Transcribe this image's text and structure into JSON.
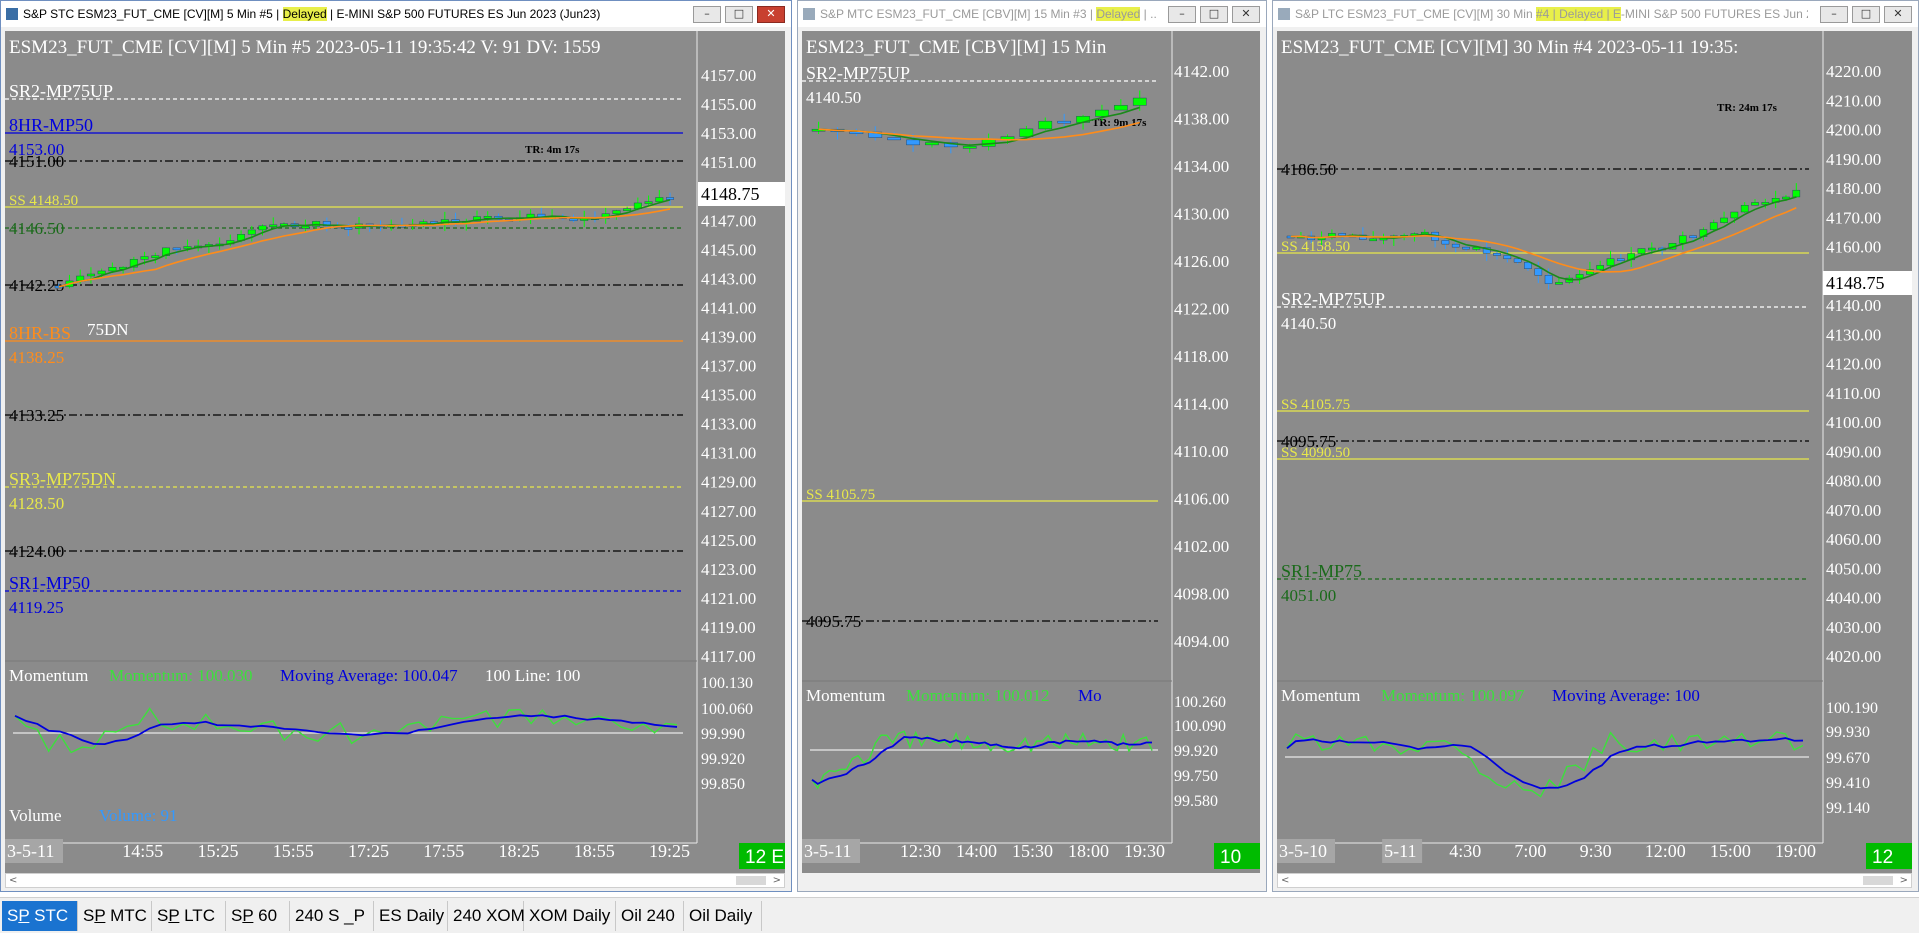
{
  "colors": {
    "chart_bg": "#8b8b8b",
    "up": "#00ff00",
    "down": "#3399ff",
    "sma_fast": "#1a8a1a",
    "sma_slow": "#ff8c1a",
    "yellow": "#e8e84a",
    "blue": "#0000dd",
    "dark_green": "#1a6a1a",
    "momentum": "#3ce03c",
    "mavg": "#0000dd",
    "highlight": "#e8ef4a"
  },
  "windows": [
    {
      "id": "stc",
      "focused": true,
      "title_pre": "S&P STC  ESM23_FUT_CME [CV][M]  5 Min  #5 | ",
      "title_hl": "Delayed",
      "title_post": " | E-MINI S&P 500 FUTURES ES Jun 2023 (Jun23)",
      "header": "ESM23_FUT_CME [CV][M]  5 Min   #5 2023-05-11 19:35:42 V: 91 DV: 1559",
      "tr_label": "TR: 4m 17s",
      "price_ticks": [
        "4157.00",
        "4155.00",
        "4153.00",
        "4151.00",
        "4149.00",
        "4147.00",
        "4145.00",
        "4143.00",
        "4141.00",
        "4139.00",
        "4137.00",
        "4135.00",
        "4133.00",
        "4131.00",
        "4129.00",
        "4127.00",
        "4125.00",
        "4123.00",
        "4121.00",
        "4119.00",
        "4117.00"
      ],
      "last_price": "4148.75",
      "levels": [
        {
          "name": "SR2-MP75UP",
          "value": null,
          "color": "white",
          "style": "dash",
          "sub": ""
        },
        {
          "name": "8HR-MP50",
          "value": "4153.00",
          "color": "blue",
          "style": "solid",
          "sub": ""
        },
        {
          "name": "",
          "value": "4151.00",
          "color": "black",
          "style": "dashdot",
          "sub": ""
        },
        {
          "name": "SS  4148.50",
          "value": null,
          "color": "yellow",
          "style": "solid",
          "sub": ""
        },
        {
          "name": "",
          "value": "4146.50",
          "color": "dark_green",
          "style": "dash",
          "sub": ""
        },
        {
          "name": "",
          "value": "4142.25",
          "color": "black",
          "style": "dashdot",
          "sub": ""
        },
        {
          "name": "8HR-BS",
          "value": "4138.25",
          "color": "orange",
          "style": "solid",
          "sub": "75DN"
        },
        {
          "name": "",
          "value": "4133.25",
          "color": "black",
          "style": "dashdot",
          "sub": ""
        },
        {
          "name": "SR3-MP75DN",
          "value": "4128.50",
          "color": "yellow",
          "style": "dash",
          "sub": ""
        },
        {
          "name": "",
          "value": "4124.00",
          "color": "black",
          "style": "dashdot",
          "sub": ""
        },
        {
          "name": "SR1-MP50",
          "value": "4119.25",
          "color": "blue",
          "style": "dash",
          "sub": ""
        }
      ],
      "momentum_label": "Momentum",
      "momentum_value": "Momentum: 100.030",
      "mavg_value": "Moving Average: 100.047",
      "line100": "100 Line: 100",
      "mom_ticks": [
        "100.130",
        "100.060",
        "99.990",
        "99.920",
        "99.850"
      ],
      "volume_label": "Volume",
      "volume_value": "Volume: 91",
      "time_labels": [
        "3-5-11",
        "14:55",
        "15:25",
        "15:55",
        "17:25",
        "17:55",
        "18:25",
        "18:55",
        "19:25"
      ],
      "corner": "12 E"
    },
    {
      "id": "mtc",
      "focused": false,
      "title_pre": "S&P MTC  ESM23_FUT_CME [CBV][M]  15 Min  #3 | ",
      "title_hl": "Delayed",
      "title_post": " | ...",
      "header": "ESM23_FUT_CME [CBV][M]  15 Min",
      "tr_label": "TR: 9m 17s",
      "price_ticks": [
        "4142.00",
        "4138.00",
        "4134.00",
        "4130.00",
        "4126.00",
        "4122.00",
        "4118.00",
        "4114.00",
        "4110.00",
        "4106.00",
        "4102.00",
        "4098.00",
        "4094.00"
      ],
      "last_price": "",
      "levels": [
        {
          "name": "SR2-MP75UP",
          "value": "4140.50",
          "color": "white",
          "style": "dash",
          "sub": ""
        },
        {
          "name": "SS  4105.75",
          "value": null,
          "color": "yellow",
          "style": "solid",
          "sub": ""
        },
        {
          "name": "",
          "value": "4095.75",
          "color": "black",
          "style": "dashdot",
          "sub": ""
        }
      ],
      "momentum_label": "Momentum",
      "momentum_value": "Momentum: 100.012",
      "mavg_value": "Mo",
      "line100": "",
      "mom_ticks": [
        "100.260",
        "100.090",
        "99.920",
        "99.750",
        "99.580"
      ],
      "volume_label": "",
      "volume_value": "",
      "time_labels": [
        "3-5-11",
        "12:30",
        "14:00",
        "15:30",
        "18:00",
        "19:30"
      ],
      "corner": "10"
    },
    {
      "id": "ltc",
      "focused": false,
      "title_pre": "S&P LTC  ESM23_FUT_CME [CV][M]  30 Min  ",
      "title_hl": "#4 | Delayed | E",
      "title_post": "-MINI S&P 500 FUTURES ES Jun 2...",
      "header": "ESM23_FUT_CME [CV][M]  30 Min   #4 2023-05-11 19:35:",
      "tr_label": "TR: 24m 17s",
      "price_ticks": [
        "4220.00",
        "4210.00",
        "4200.00",
        "4190.00",
        "4180.00",
        "4170.00",
        "4160.00",
        "4150.00",
        "4140.00",
        "4130.00",
        "4120.00",
        "4110.00",
        "4100.00",
        "4090.00",
        "4080.00",
        "4070.00",
        "4060.00",
        "4050.00",
        "4040.00",
        "4030.00",
        "4020.00"
      ],
      "last_price": "4148.75",
      "levels": [
        {
          "name": "",
          "value": "4186.50",
          "color": "black",
          "style": "dashdot",
          "sub": ""
        },
        {
          "name": "SS  4158.50",
          "value": null,
          "color": "yellow",
          "style": "solid",
          "sub": ""
        },
        {
          "name": "SR2-MP75UP",
          "value": "4140.50",
          "color": "white",
          "style": "dash",
          "sub": ""
        },
        {
          "name": "SS  4105.75",
          "value": null,
          "color": "yellow",
          "style": "solid",
          "sub": ""
        },
        {
          "name": "",
          "value": "4095.75",
          "color": "black",
          "style": "dashdot",
          "sub": ""
        },
        {
          "name": "SS  4090.50",
          "value": null,
          "color": "yellow",
          "style": "solid",
          "sub": ""
        },
        {
          "name": "SR1-MP75",
          "value": "4051.00",
          "color": "dark_green",
          "style": "dash",
          "sub": ""
        }
      ],
      "momentum_label": "Momentum",
      "momentum_value": "Momentum: 100.097",
      "mavg_value": "Moving Average: 100",
      "line100": "",
      "mom_ticks": [
        "100.190",
        "99.930",
        "99.670",
        "99.410",
        "99.140"
      ],
      "volume_label": "",
      "volume_value": "",
      "time_labels": [
        "3-5-10",
        "5-11",
        "4:30",
        "7:00",
        "9:30",
        "12:00",
        "15:00",
        "19:00"
      ],
      "corner": "12"
    }
  ],
  "taskbar": {
    "tabs": [
      {
        "pre": "S",
        "ul": "P",
        "post": " STC",
        "active": true
      },
      {
        "pre": "S",
        "ul": "P",
        "post": " MTC",
        "active": false
      },
      {
        "pre": "S",
        "ul": "P",
        "post": " LTC",
        "active": false
      },
      {
        "pre": "S",
        "ul": "P",
        "post": " 60",
        "active": false
      },
      {
        "pre": "240 S _P",
        "ul": "",
        "post": "",
        "active": false
      },
      {
        "pre": "ES Daily",
        "ul": "",
        "post": "",
        "active": false
      },
      {
        "pre": "240 XOM",
        "ul": "",
        "post": "",
        "active": false
      },
      {
        "pre": "XOM Daily",
        "ul": "",
        "post": "",
        "active": false
      },
      {
        "pre": "Oil 240",
        "ul": "",
        "post": "",
        "active": false
      },
      {
        "pre": "Oil Daily",
        "ul": "",
        "post": "",
        "active": false
      }
    ]
  },
  "window_controls": {
    "minimize": "–",
    "maximize": "□",
    "close": "✕"
  }
}
